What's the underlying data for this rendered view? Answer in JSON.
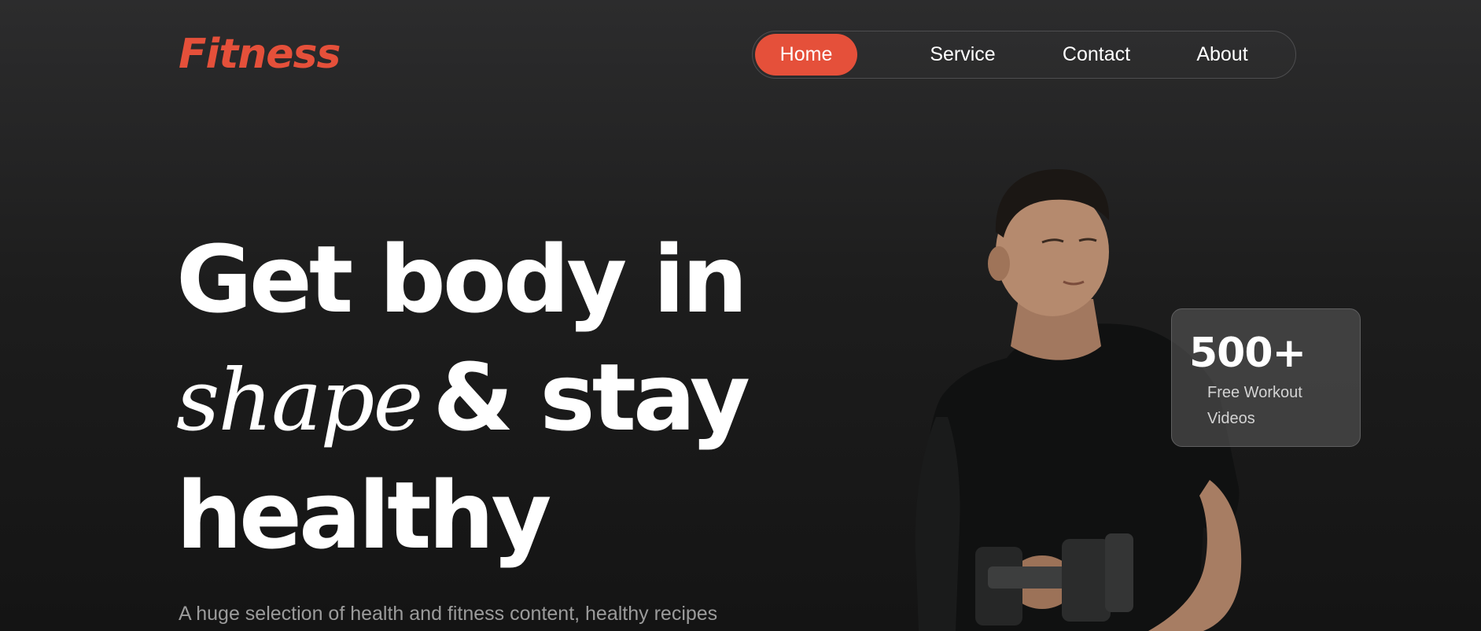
{
  "brand": {
    "name": "Fitness",
    "color": "#e5503a"
  },
  "nav": {
    "items": [
      {
        "label": "Home",
        "active": true
      },
      {
        "label": "Service",
        "active": false
      },
      {
        "label": "Contact",
        "active": false
      },
      {
        "label": "About",
        "active": false
      }
    ]
  },
  "hero": {
    "line1": "Get body in",
    "script_word": "shape",
    "line2_rest": "& stay",
    "line3": "healthy",
    "subtitle": "A huge selection of health and fitness content, healthy recipes"
  },
  "stat": {
    "value": "500+",
    "label": "Free Workout Videos"
  },
  "colors": {
    "accent": "#e5503a",
    "background": "#1d1d1d",
    "card": "#5f5f5f"
  }
}
